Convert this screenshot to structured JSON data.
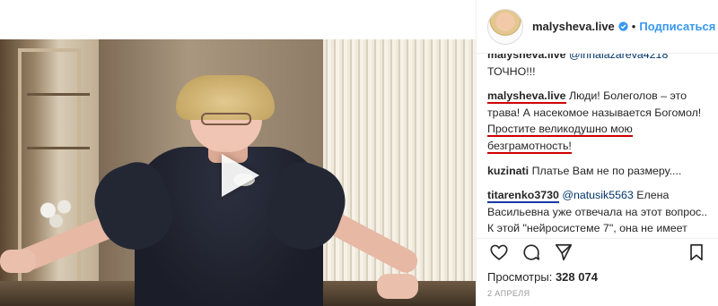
{
  "post": {
    "username": "malysheva.live",
    "follow_label": "Подписаться",
    "separator": "•",
    "verified_icon": "verified-badge-icon",
    "accent_color": "#3897f0"
  },
  "media": {
    "type": "video",
    "play_icon": "play-icon"
  },
  "comments": [
    {
      "user": "malysheva.live",
      "mention": "@irinalazareva4218",
      "text": "ТОЧНО!!!"
    },
    {
      "user": "malysheva.live",
      "text_part1": "Люди! Болеголов – это",
      "text_part2": "трава! А насекомое называется Богомол!",
      "text_part3": "Простите великодушно мою",
      "text_part4": "безграмотность!"
    },
    {
      "user": "kuzinati",
      "text": "Платье Вам не по размеру...."
    },
    {
      "user": "titarenko3730",
      "mention": "@natusik5563",
      "text": "Елена Васильевна уже отвечала на этот вопрос.. К этой \"нейросистеме 7\", она не имеет никакого отношения.. Мошенники.. 😩"
    }
  ],
  "actions": {
    "like_icon": "heart-icon",
    "comment_icon": "comment-icon",
    "share_icon": "share-icon",
    "save_icon": "bookmark-icon"
  },
  "stats": {
    "views_label": "Просмотры:",
    "views_value": "328 074",
    "date": "2 АПРЕЛЯ"
  },
  "colors": {
    "underline_red": "#d00000",
    "underline_blue": "#1737a8",
    "mention": "#003569"
  }
}
